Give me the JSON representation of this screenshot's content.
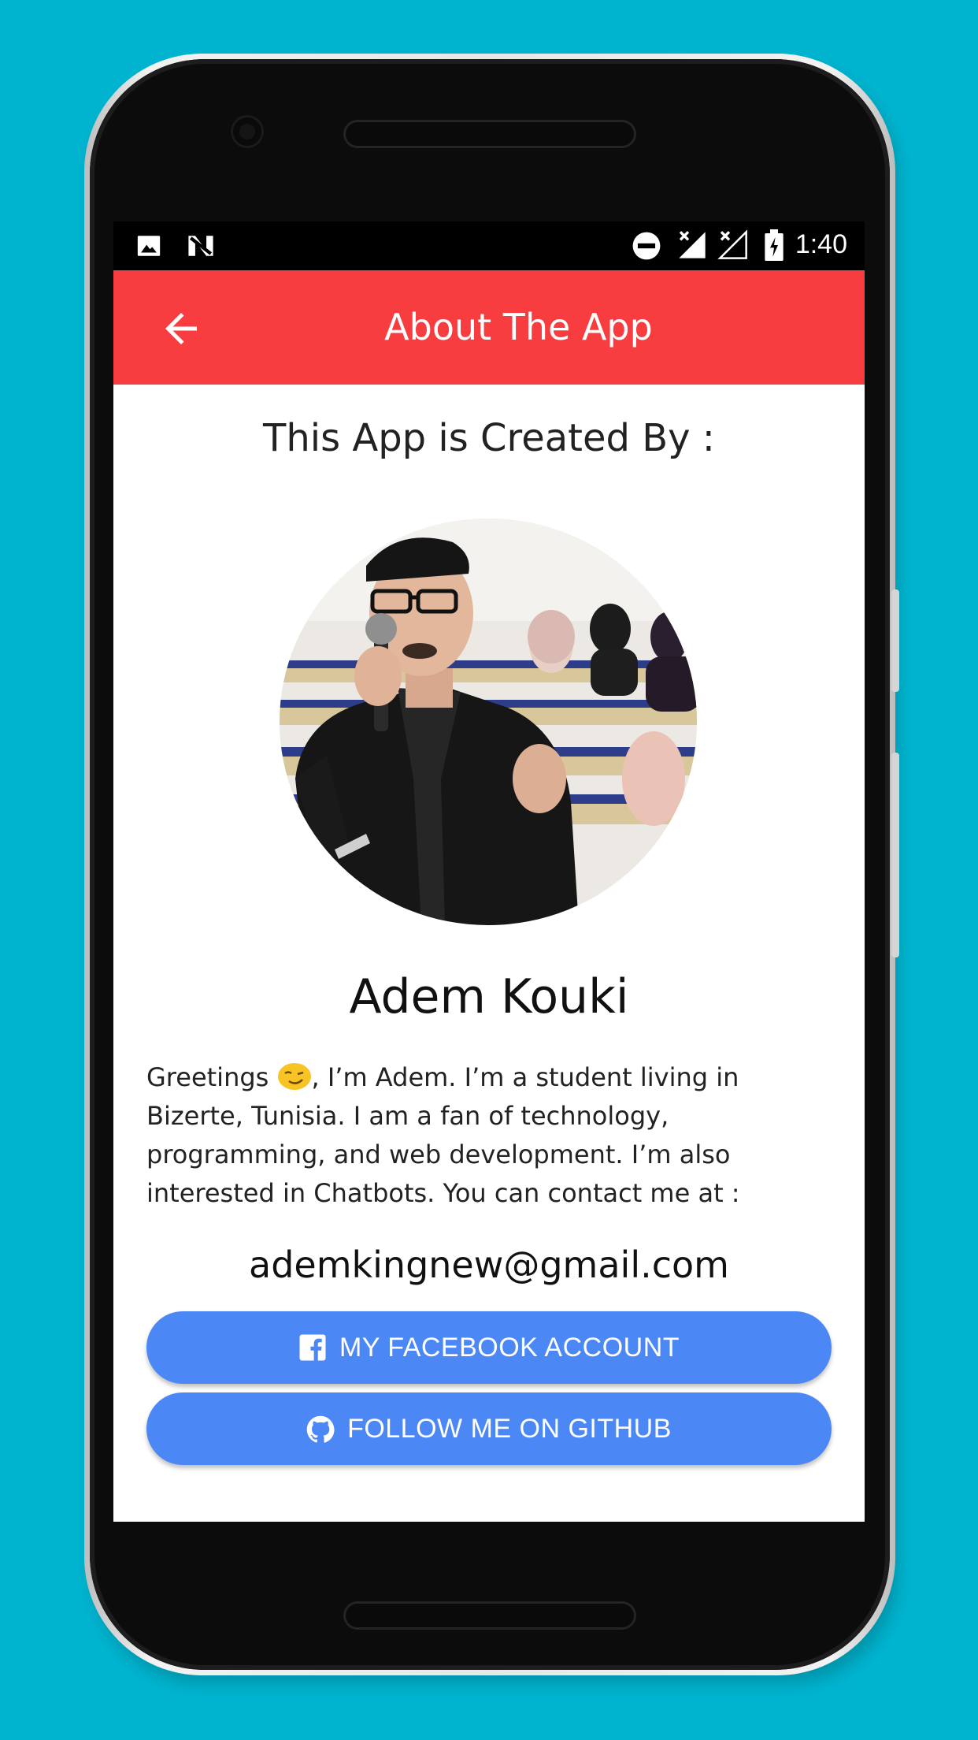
{
  "status_bar": {
    "time": "1:40",
    "left_icons": [
      "image-icon",
      "n-icon"
    ],
    "right_icons": [
      "do-not-disturb-icon",
      "signal-off-icon",
      "signal-off-icon",
      "battery-charging-icon"
    ]
  },
  "app_bar": {
    "title": "About The App",
    "back_icon": "arrow-left-icon",
    "color": "#f73d3f"
  },
  "content": {
    "created_by_label": "This App is Created By :",
    "author_name": "Adem Kouki",
    "bio_before_emoji": "Greetings ",
    "bio_after_emoji": ", I’m Adem. I’m a student living in Bizerte, Tunisia. I am a fan of technology, programming, and web development. I’m also interested in Chatbots. You can contact me at :",
    "email": "ademkingnew@gmail.com"
  },
  "buttons": {
    "facebook_label": "MY FACEBOOK ACCOUNT",
    "facebook_icon": "facebook-icon",
    "github_label": "FOLLOW ME ON GITHUB",
    "github_icon": "github-icon",
    "color": "#4b88f5"
  }
}
